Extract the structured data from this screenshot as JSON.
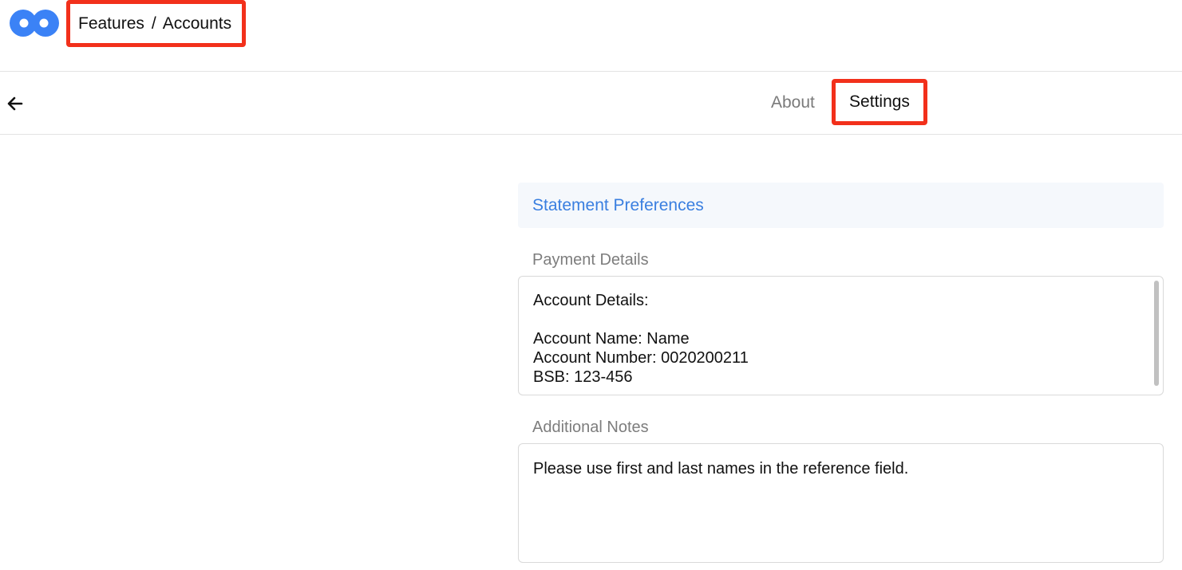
{
  "header": {
    "logo_icon": "double-circle-logo-icon",
    "brand_color": "#3b82f6",
    "breadcrumb": {
      "parent": "Features",
      "separator": "/",
      "current": "Accounts"
    }
  },
  "nav": {
    "back_icon": "arrow-left-icon",
    "tabs": [
      {
        "label": "About",
        "active": false
      },
      {
        "label": "Settings",
        "active": true
      }
    ]
  },
  "main": {
    "section_title": "Statement Preferences",
    "payment": {
      "label": "Payment Details",
      "value": "Account Details:\n\nAccount Name: Name\nAccount Number: 0020200211\nBSB: 123-456"
    },
    "notes": {
      "label": "Additional Notes",
      "value": "Please use first and last names in the reference field."
    }
  },
  "colors": {
    "highlight": "#f2301b",
    "link": "#3a7fe0"
  }
}
